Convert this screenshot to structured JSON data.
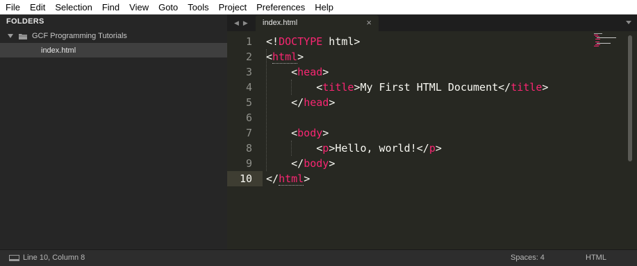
{
  "menu": [
    "File",
    "Edit",
    "Selection",
    "Find",
    "View",
    "Goto",
    "Tools",
    "Project",
    "Preferences",
    "Help"
  ],
  "sidebar": {
    "header": "FOLDERS",
    "folder": "GCF Programming Tutorials",
    "file": "index.html"
  },
  "tabs": {
    "nav_left": "◀",
    "nav_right": "▶",
    "active_label": "index.html",
    "close_glyph": "×"
  },
  "editor": {
    "line_numbers": [
      "1",
      "2",
      "3",
      "4",
      "5",
      "6",
      "7",
      "8",
      "9",
      "10"
    ],
    "active_line": "10",
    "code": {
      "l1_open": "<!",
      "l1_doctype": "DOCTYPE",
      "l1_rest": " html>",
      "html_tag": "html",
      "head_tag": "head",
      "title_tag": "title",
      "title_text": "My First HTML Document",
      "body_tag": "body",
      "p_tag": "p",
      "p_text": "Hello, world!"
    }
  },
  "status": {
    "position": "Line 10, Column 8",
    "spaces": "Spaces: 4",
    "language": "HTML"
  },
  "colors": {
    "tag": "#f92672",
    "text": "#f8f8f2",
    "background": "#272822",
    "gutter_text": "#8f908a"
  }
}
